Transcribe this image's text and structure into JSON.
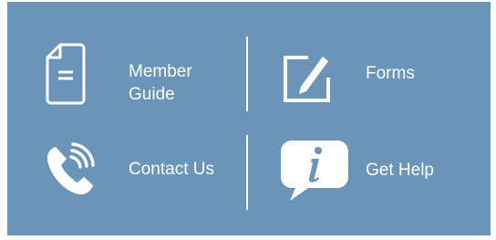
{
  "colors": {
    "panel_background": "#6b95b8",
    "foreground": "#ffffff"
  },
  "tiles": [
    {
      "label": "Member\nGuide",
      "icon": "document-icon"
    },
    {
      "label": "Forms",
      "icon": "edit-icon"
    },
    {
      "label": "Contact Us",
      "icon": "phone-icon"
    },
    {
      "label": "Get Help",
      "icon": "info-bubble-icon"
    }
  ]
}
